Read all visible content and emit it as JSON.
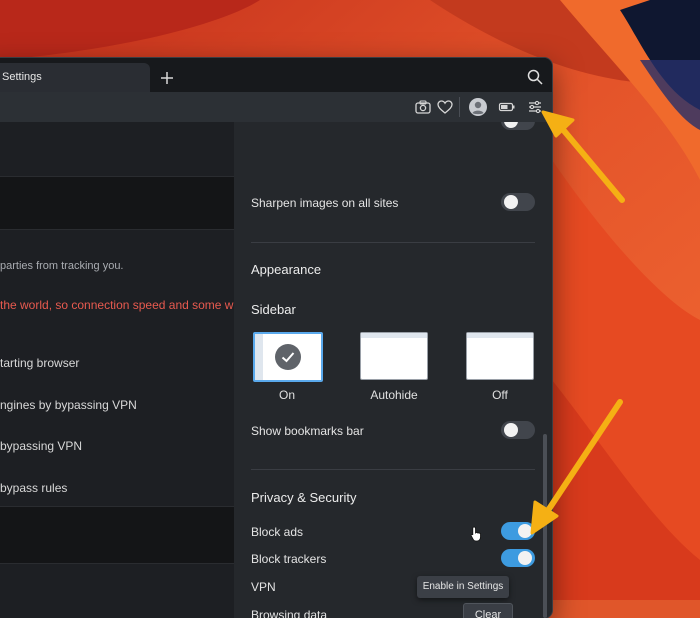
{
  "window": {
    "tab_title": "Settings",
    "new_tab_icon": "plus-icon",
    "search_icon": "search-icon"
  },
  "toolbar": {
    "icons": [
      "camera-icon",
      "heart-icon",
      "avatar",
      "battery-icon",
      "quick-settings-icon"
    ]
  },
  "left_page": {
    "tracking_text": "parties from tracking you.",
    "warning_text": "the world, so connection speed and some we",
    "items": [
      "tarting browser",
      "ngines by bypassing VPN",
      "bypassing VPN",
      "bypass rules"
    ],
    "warning_color": "#e85a4f"
  },
  "panel": {
    "sharpen_label": "Sharpen images on all sites",
    "sharpen_on": false,
    "appearance_heading": "Appearance",
    "sidebar_heading": "Sidebar",
    "sidebar_options": [
      "On",
      "Autohide",
      "Off"
    ],
    "sidebar_selected": "On",
    "bookmarks_label": "Show bookmarks bar",
    "bookmarks_on": false,
    "privacy_heading": "Privacy & Security",
    "block_ads_label": "Block ads",
    "block_ads_on": true,
    "block_trackers_label": "Block trackers",
    "block_trackers_on": true,
    "vpn_label": "VPN",
    "vpn_tooltip": "Enable in Settings",
    "browsing_data_label": "Browsing data",
    "clear_label": "Clear",
    "accent_color": "#3d9be0"
  },
  "annotations": {
    "arrow_color": "#f5b014"
  }
}
